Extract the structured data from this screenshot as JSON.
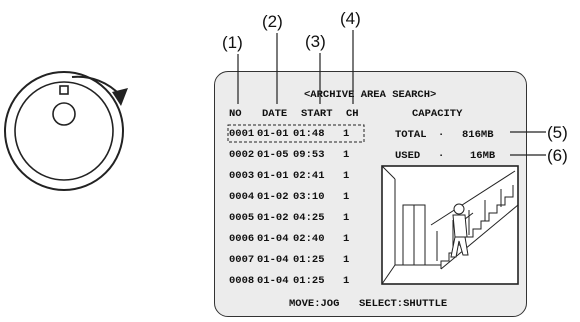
{
  "callouts": [
    "(1)",
    "(2)",
    "(3)",
    "(4)",
    "(5)",
    "(6)"
  ],
  "screen": {
    "title": "<ARCHIVE AREA SEARCH>",
    "headers": {
      "no": "NO",
      "date": "DATE",
      "start": "START",
      "ch": "CH",
      "capacity": "CAPACITY"
    },
    "rows": [
      {
        "no": "0001",
        "date": "01-01",
        "start": "01:48",
        "ch": "1"
      },
      {
        "no": "0002",
        "date": "01-05",
        "start": "09:53",
        "ch": "1"
      },
      {
        "no": "0003",
        "date": "01-01",
        "start": "02:41",
        "ch": "1"
      },
      {
        "no": "0004",
        "date": "01-02",
        "start": "03:10",
        "ch": "1"
      },
      {
        "no": "0005",
        "date": "01-02",
        "start": "04:25",
        "ch": "1"
      },
      {
        "no": "0006",
        "date": "01-04",
        "start": "02:40",
        "ch": "1"
      },
      {
        "no": "0007",
        "date": "01-04",
        "start": "01:25",
        "ch": "1"
      },
      {
        "no": "0008",
        "date": "01-04",
        "start": "01:25",
        "ch": "1"
      }
    ],
    "total": {
      "label": "TOTAL",
      "sep": "·",
      "value": "816MB"
    },
    "used": {
      "label": "USED",
      "sep": "·",
      "value": "16MB"
    },
    "footer": {
      "move": "MOVE:JOG",
      "select": "SELECT:SHUTTLE"
    }
  }
}
